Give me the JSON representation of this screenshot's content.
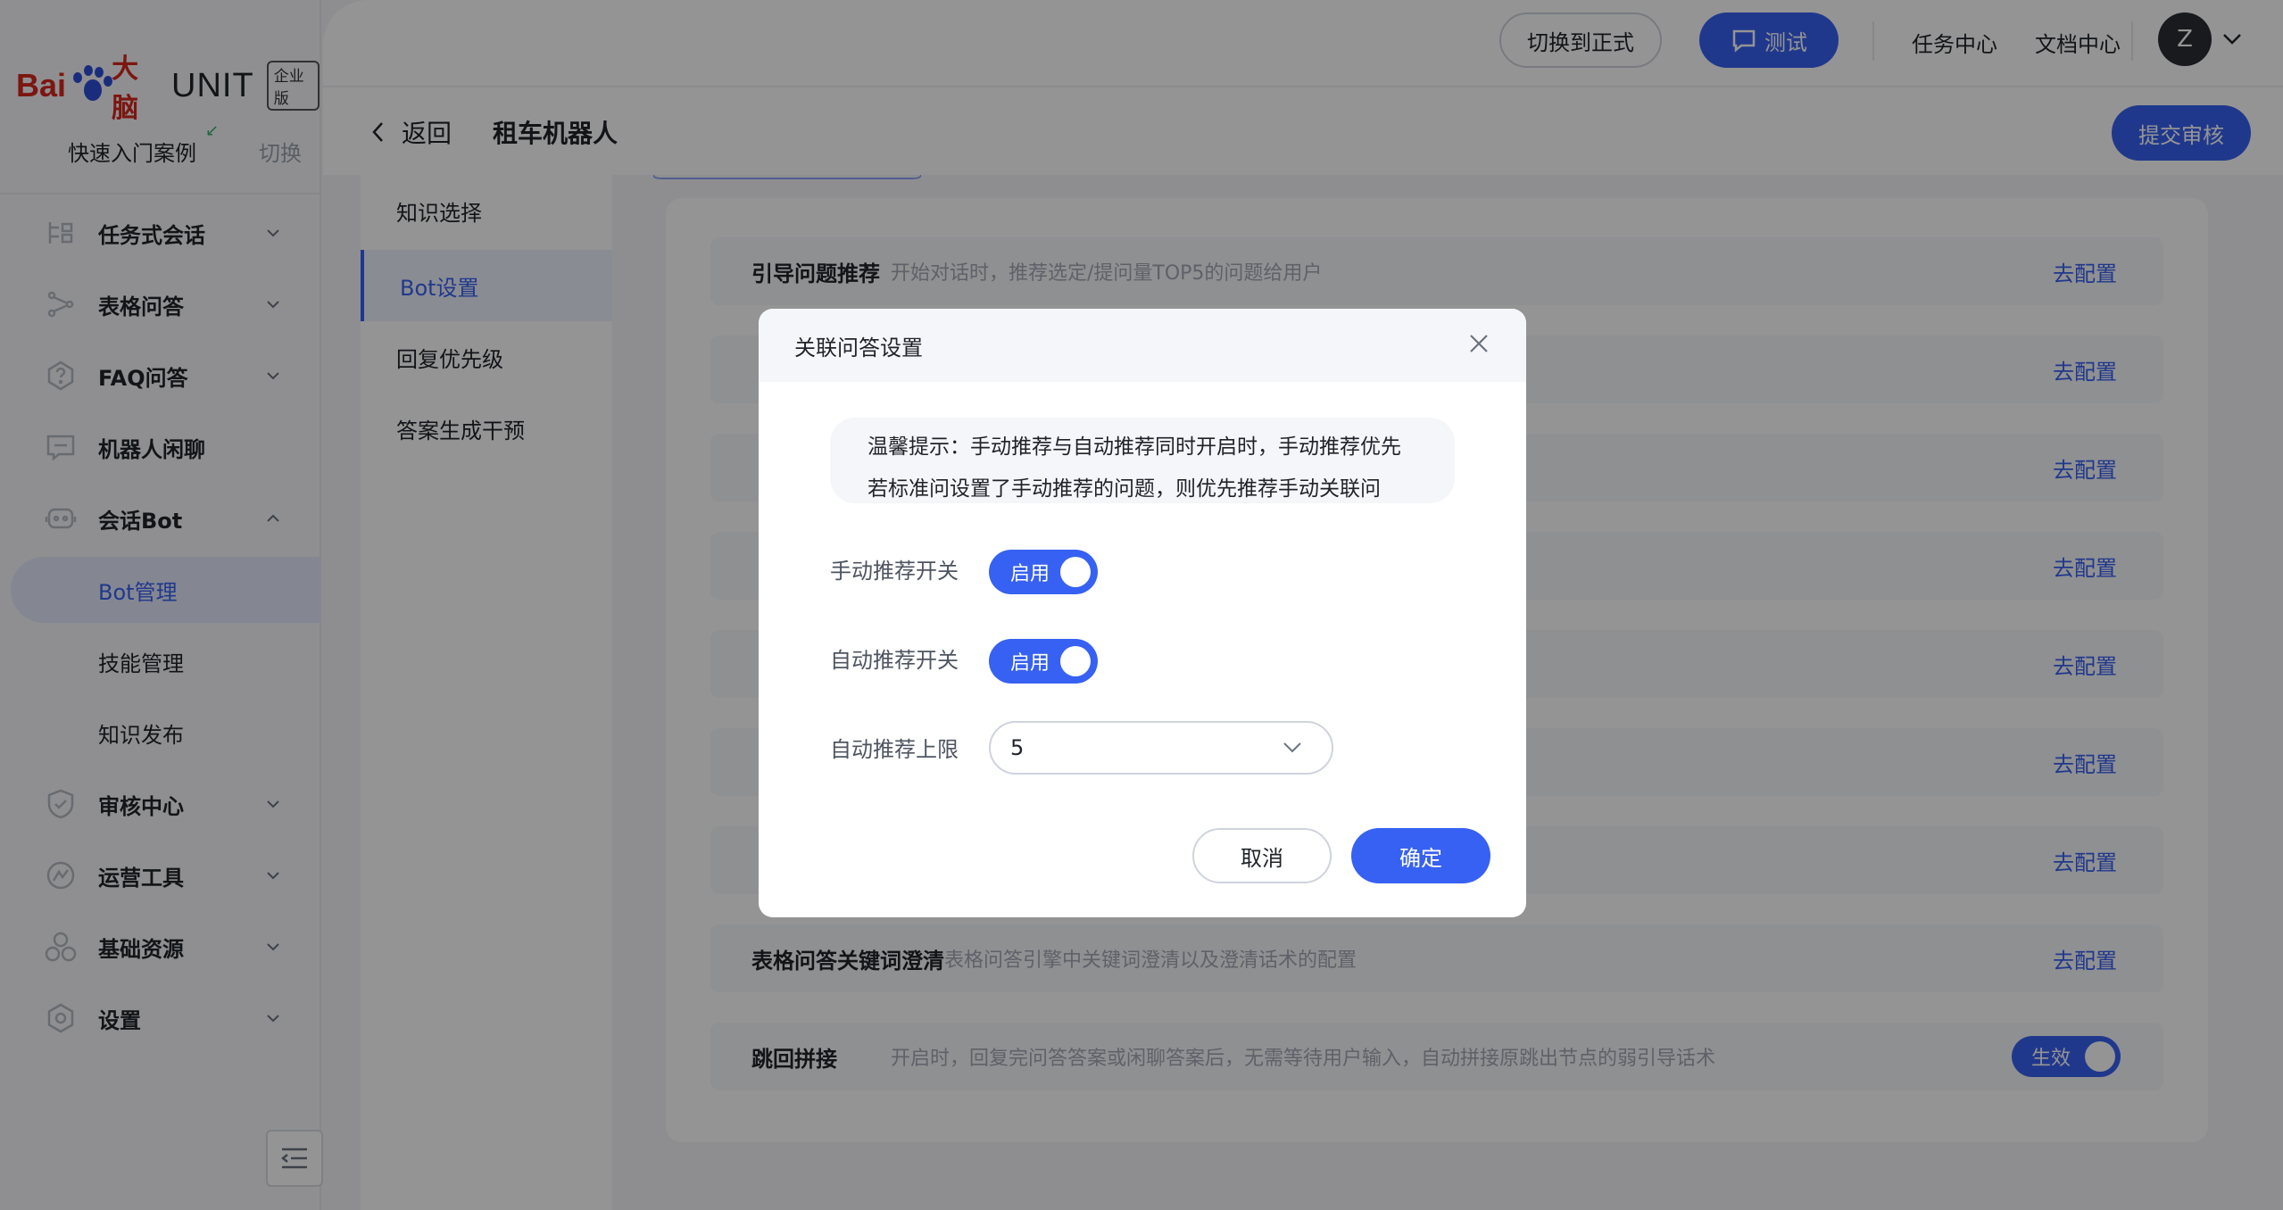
{
  "logo": {
    "bai": "Bai",
    "du": "大脑",
    "unit": "UNIT",
    "badge": "企业版"
  },
  "sidebar": {
    "quick_label": "快速入门案例",
    "switch_label": "切换",
    "menu": [
      {
        "label": "任务式会话",
        "icon": "task-dialog-icon"
      },
      {
        "label": "表格问答",
        "icon": "table-qa-icon"
      },
      {
        "label": "FAQ问答",
        "icon": "faq-icon"
      },
      {
        "label": "机器人闲聊",
        "icon": "chat-icon"
      },
      {
        "label": "会话Bot",
        "icon": "bot-icon"
      },
      {
        "label": "审核中心",
        "icon": "review-icon"
      },
      {
        "label": "运营工具",
        "icon": "ops-icon"
      },
      {
        "label": "基础资源",
        "icon": "resource-icon"
      },
      {
        "label": "设置",
        "icon": "settings-icon"
      }
    ],
    "bot_sub": [
      "Bot管理",
      "技能管理",
      "知识发布"
    ]
  },
  "topbar": {
    "switch_formal": "切换到正式",
    "test": "测试",
    "task_center": "任务中心",
    "doc_center": "文档中心",
    "avatar_letter": "Z"
  },
  "header": {
    "back": "返回",
    "title": "租车机器人",
    "submit": "提交审核"
  },
  "subnav": [
    "知识选择",
    "Bot设置",
    "回复优先级",
    "答案生成干预"
  ],
  "rows": [
    {
      "title": "引导问题推荐",
      "desc": "开始对话时，推荐选定/提问量TOP5的问题给用户",
      "action": "去配置"
    },
    {
      "title": "",
      "desc": "",
      "action": "去配置"
    },
    {
      "title": "",
      "desc": "",
      "action": "去配置"
    },
    {
      "title": "",
      "desc": "",
      "action": "去配置"
    },
    {
      "title": "",
      "desc": "",
      "action": "去配置"
    },
    {
      "title": "",
      "desc": "",
      "action": "去配置"
    },
    {
      "title": "",
      "desc": "",
      "action": "去配置"
    },
    {
      "title": "表格问答关键词澄清",
      "desc": "表格问答引擎中关键词澄清以及澄清话术的配置",
      "action": "去配置"
    },
    {
      "title": "跳回拼接",
      "desc": "开启时，回复完问答答案或闲聊答案后，无需等待用户输入，自动拼接原跳出节点的弱引导话术",
      "toggle": "生效",
      "toggle_on": true
    }
  ],
  "modal": {
    "title": "关联问答设置",
    "tip_line1": "温馨提示：手动推荐与自动推荐同时开启时，手动推荐优先",
    "tip_line2": "若标准问设置了手动推荐的问题，则优先推荐手动关联问",
    "manual_label": "手动推荐开关",
    "manual_toggle": "启用",
    "manual_on": true,
    "auto_label": "自动推荐开关",
    "auto_toggle": "启用",
    "auto_on": true,
    "limit_label": "自动推荐上限",
    "limit_value": "5",
    "cancel": "取消",
    "confirm": "确定"
  },
  "colors": {
    "primary": "#3761f2",
    "brand_red": "#d6261c",
    "overlay": "rgba(0,0,0,0.42)"
  }
}
